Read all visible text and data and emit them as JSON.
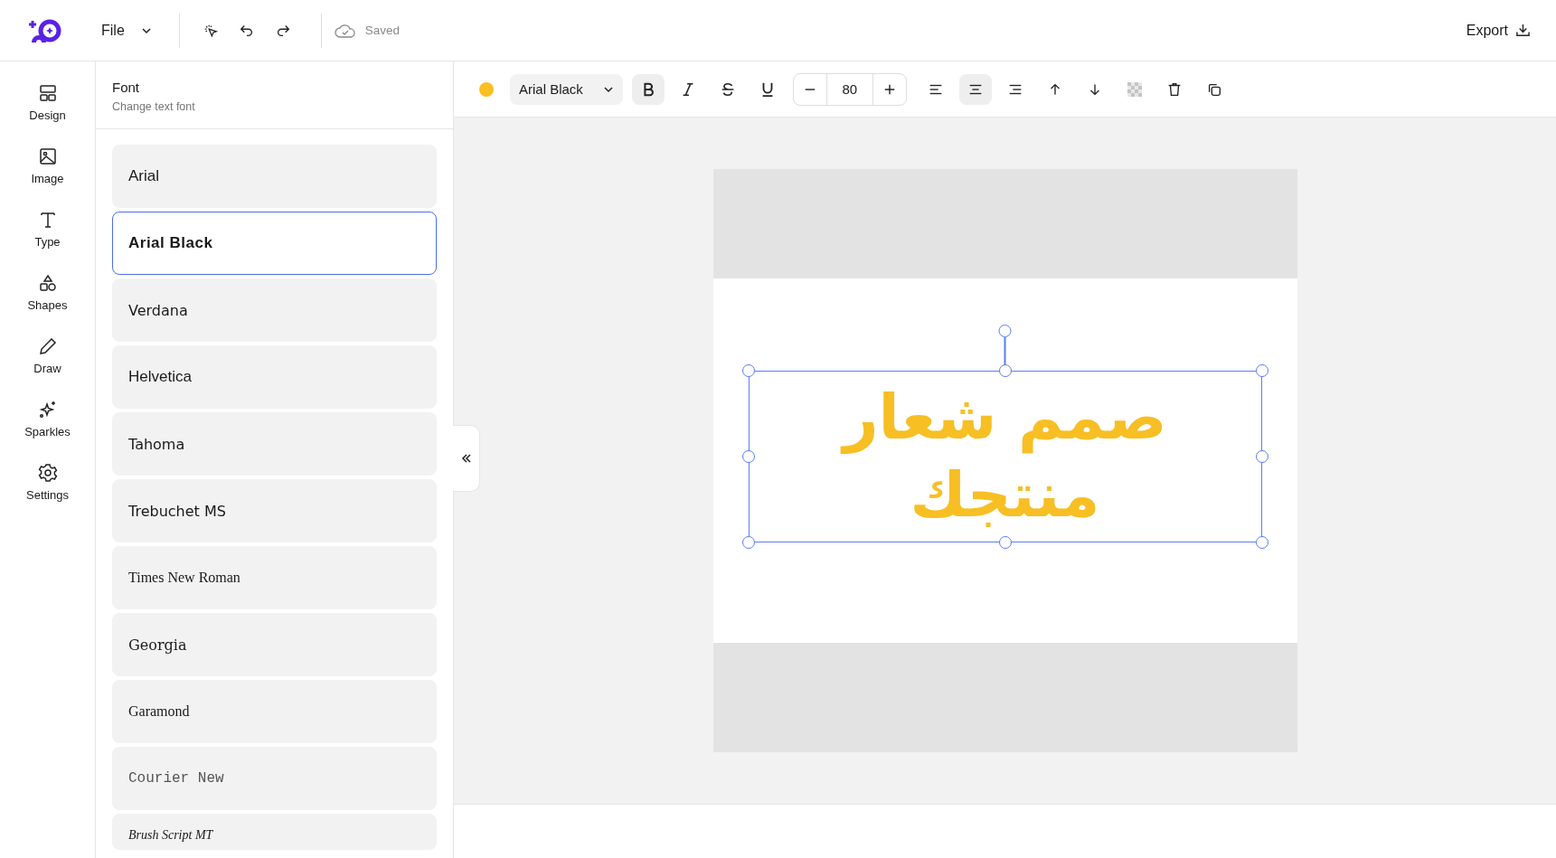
{
  "topbar": {
    "menu": "File",
    "save_status": "Saved",
    "export": "Export"
  },
  "rail": [
    {
      "label": "Design"
    },
    {
      "label": "Image"
    },
    {
      "label": "Type"
    },
    {
      "label": "Shapes"
    },
    {
      "label": "Draw"
    },
    {
      "label": "Sparkles"
    },
    {
      "label": "Settings"
    }
  ],
  "panel": {
    "title": "Font",
    "subtitle": "Change text font",
    "fonts": [
      {
        "name": "Arial",
        "kind": "sans",
        "selected": false
      },
      {
        "name": "Arial Black",
        "kind": "black",
        "selected": true
      },
      {
        "name": "Verdana",
        "kind": "wide",
        "selected": false
      },
      {
        "name": "Helvetica",
        "kind": "sans",
        "selected": false
      },
      {
        "name": "Tahoma",
        "kind": "wide",
        "selected": false
      },
      {
        "name": "Trebuchet MS",
        "kind": "wide",
        "selected": false
      },
      {
        "name": "Times New Roman",
        "kind": "serif",
        "selected": false
      },
      {
        "name": "Georgia",
        "kind": "serif-wide",
        "selected": false
      },
      {
        "name": "Garamond",
        "kind": "serif",
        "selected": false
      },
      {
        "name": "Courier New",
        "kind": "mono",
        "selected": false
      },
      {
        "name": "Brush Script MT",
        "kind": "script",
        "selected": false
      }
    ]
  },
  "toolbar": {
    "color": "#fbbf24",
    "font": "Arial Black",
    "bold": true,
    "italic": false,
    "strikethrough": false,
    "underline": false,
    "size": "80",
    "align": [
      {
        "kind": "left",
        "selected": false
      },
      {
        "kind": "center",
        "selected": true
      },
      {
        "kind": "right",
        "selected": false
      }
    ]
  },
  "canvas": {
    "lines": [
      "صمم شعار",
      "منتجك"
    ],
    "color": "#f7bf24",
    "selected": true
  }
}
